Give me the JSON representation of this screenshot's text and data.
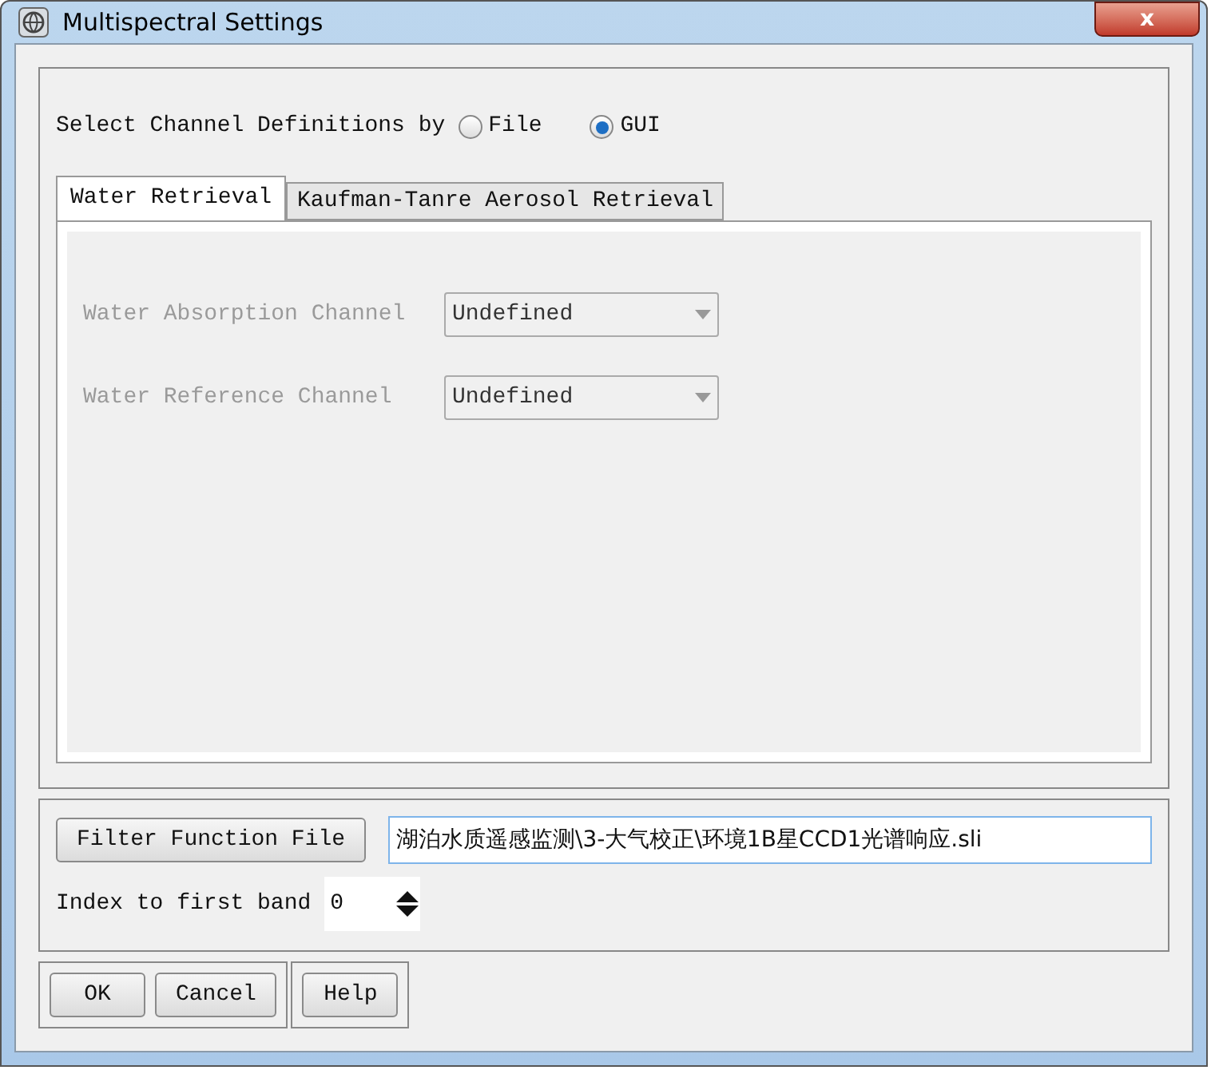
{
  "window": {
    "title": "Multispectral Settings",
    "close": "x"
  },
  "channel_definitions": {
    "label": "Select Channel Definitions by",
    "options": [
      {
        "label": "File",
        "selected": false
      },
      {
        "label": "GUI",
        "selected": true
      }
    ]
  },
  "tabs": [
    {
      "label": "Water Retrieval",
      "selected": true
    },
    {
      "label": "Kaufman-Tanre Aerosol Retrieval",
      "selected": false
    }
  ],
  "fields": [
    {
      "label": "Water Absorption Channel",
      "value": "Undefined",
      "disabled": true
    },
    {
      "label": "Water Reference Channel",
      "value": "Undefined",
      "disabled": true
    }
  ],
  "filter_function": {
    "button": "Filter Function File",
    "value": "湖泊水质遥感监测\\3-大气校正\\环境1B星CCD1光谱响应.sli"
  },
  "index_first_band": {
    "label": "Index to first band",
    "value": "0"
  },
  "button_groups": [
    [
      "OK",
      "Cancel"
    ],
    [
      "Help"
    ]
  ]
}
